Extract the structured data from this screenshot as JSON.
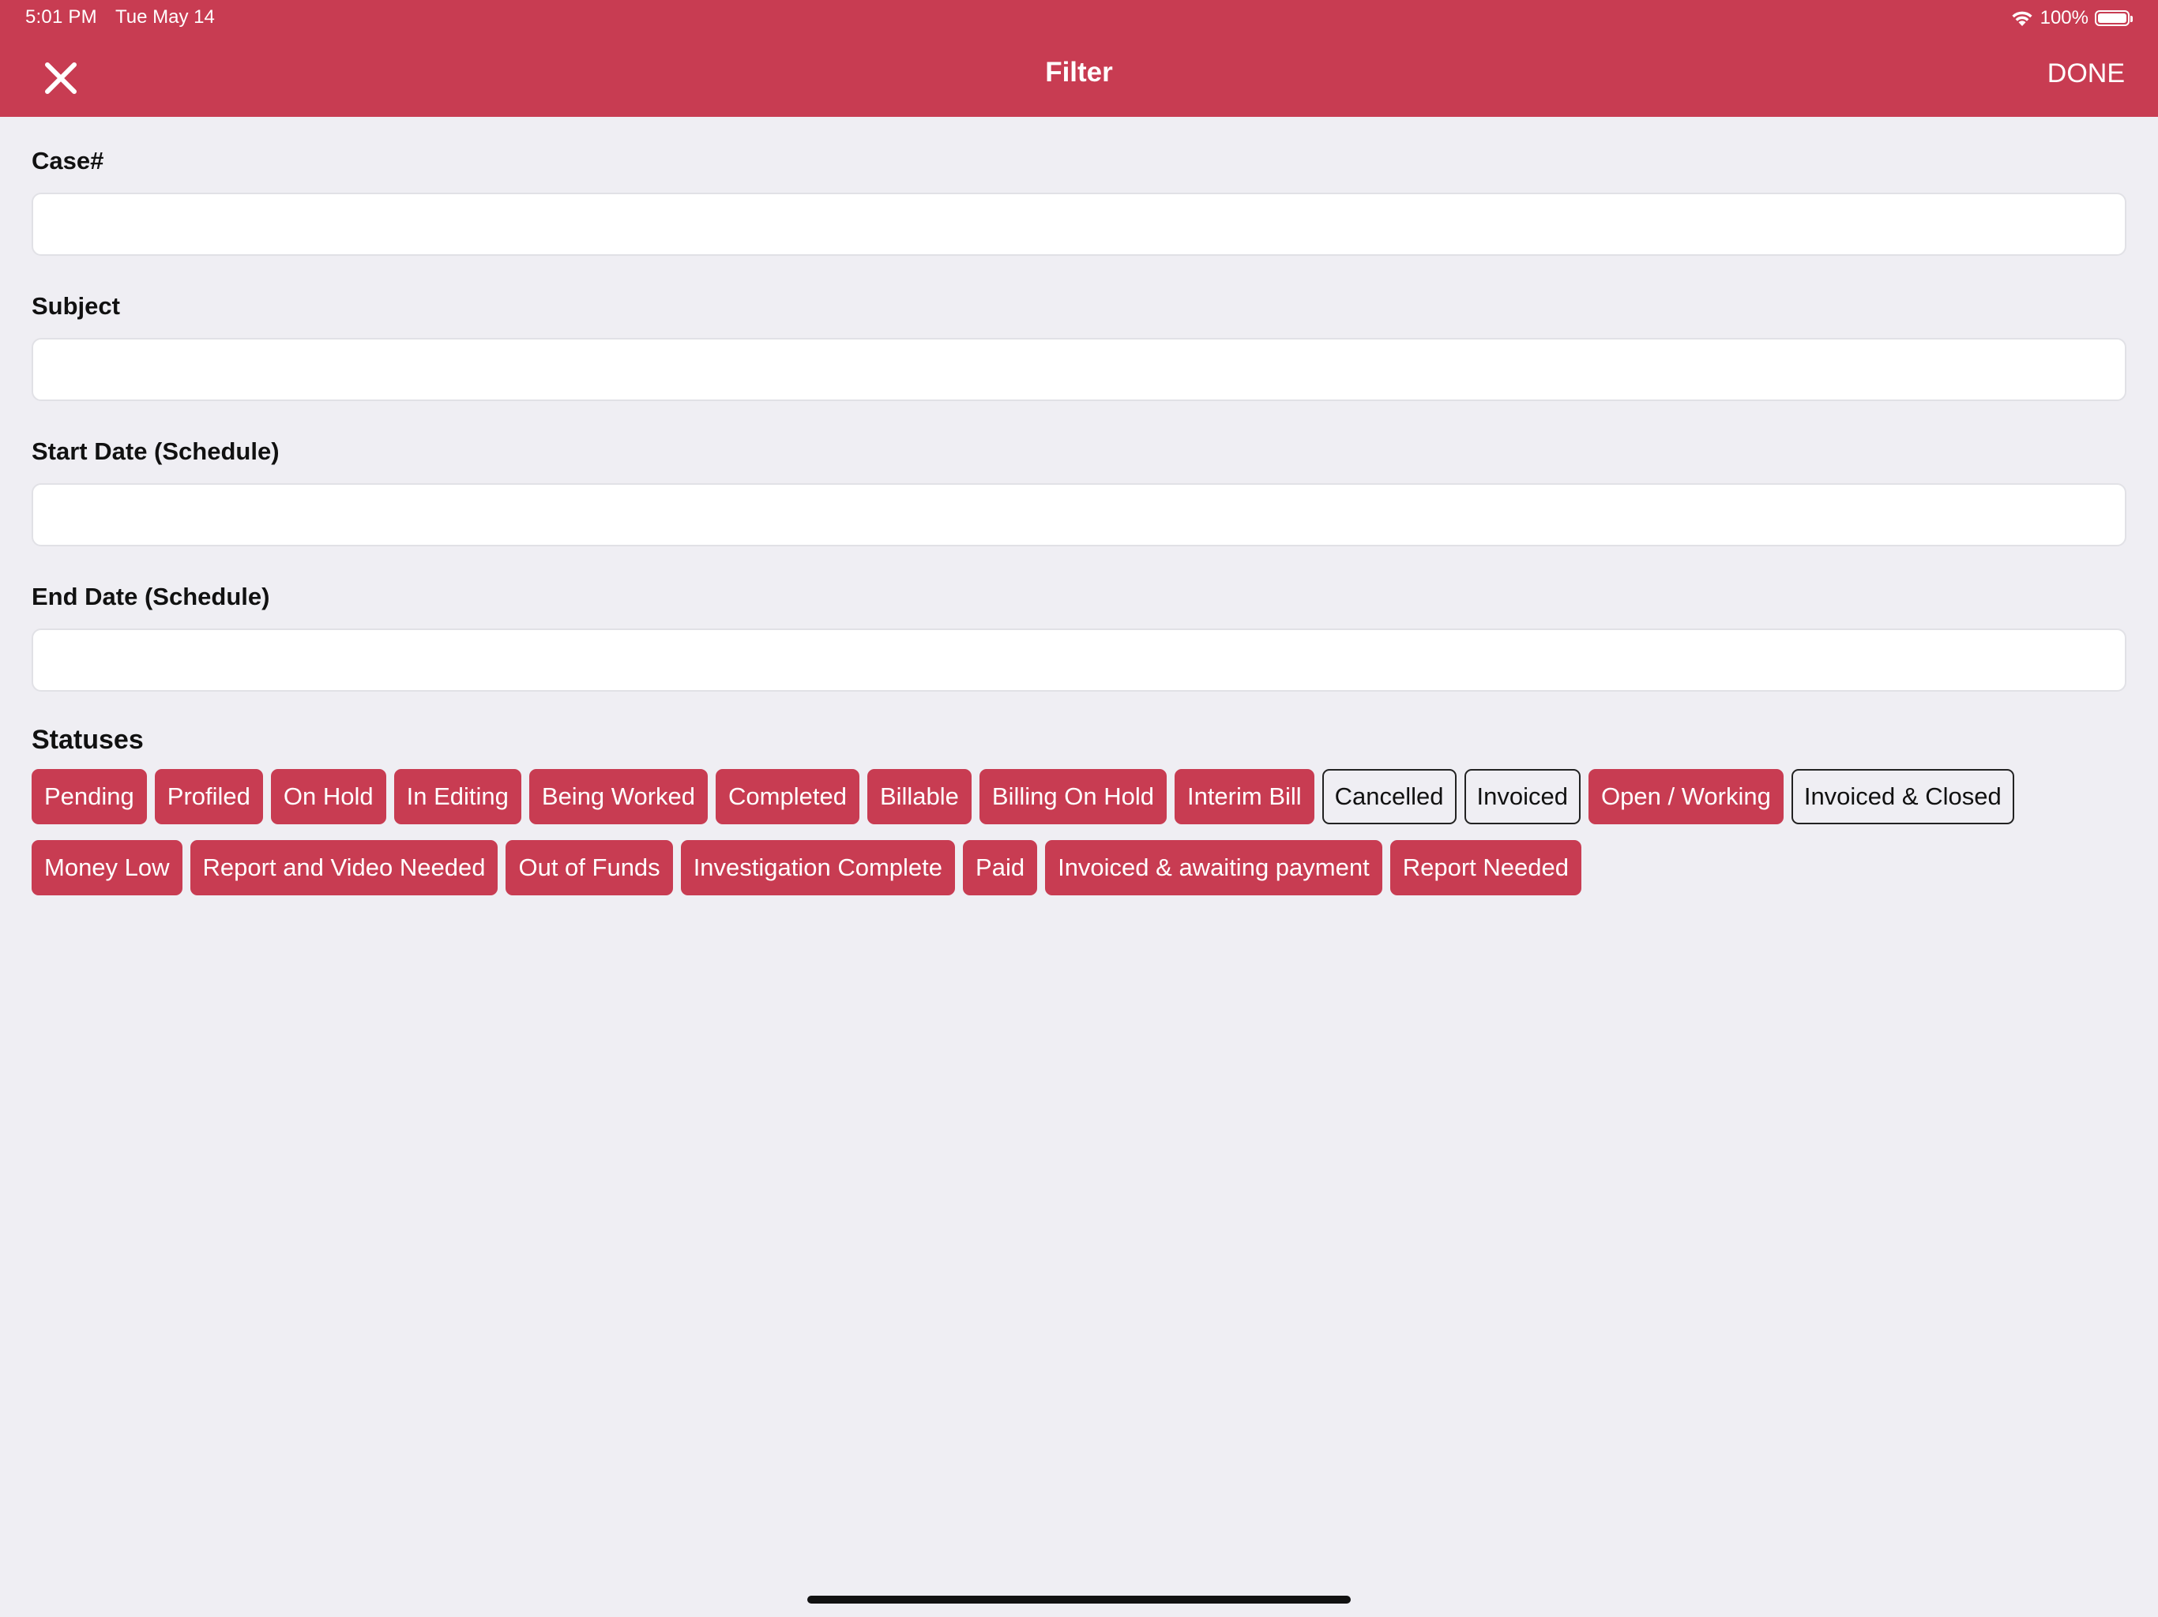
{
  "status_bar": {
    "time": "5:01 PM",
    "date": "Tue May 14",
    "battery": "100%"
  },
  "nav": {
    "title": "Filter",
    "done_label": "DONE",
    "close_icon": "close-icon"
  },
  "fields": {
    "case": {
      "label": "Case#",
      "value": ""
    },
    "subject": {
      "label": "Subject",
      "value": ""
    },
    "start_date": {
      "label": "Start Date (Schedule)",
      "value": ""
    },
    "end_date": {
      "label": "End Date (Schedule)",
      "value": ""
    }
  },
  "statuses": {
    "label": "Statuses",
    "items": [
      {
        "label": "Pending",
        "selected": true
      },
      {
        "label": "Profiled",
        "selected": true
      },
      {
        "label": "On Hold",
        "selected": true
      },
      {
        "label": "In Editing",
        "selected": true
      },
      {
        "label": "Being Worked",
        "selected": true
      },
      {
        "label": "Completed",
        "selected": true
      },
      {
        "label": "Billable",
        "selected": true
      },
      {
        "label": "Billing On Hold",
        "selected": true
      },
      {
        "label": "Interim Bill",
        "selected": true
      },
      {
        "label": "Cancelled",
        "selected": false
      },
      {
        "label": "Invoiced",
        "selected": false
      },
      {
        "label": "Open / Working",
        "selected": true
      },
      {
        "label": "Invoiced & Closed",
        "selected": false
      },
      {
        "label": "Money Low",
        "selected": true
      },
      {
        "label": "Report and Video Needed",
        "selected": true
      },
      {
        "label": "Out of Funds",
        "selected": true
      },
      {
        "label": "Investigation Complete",
        "selected": true
      },
      {
        "label": "Paid",
        "selected": true
      },
      {
        "label": "Invoiced & awaiting payment",
        "selected": true
      },
      {
        "label": "Report Needed",
        "selected": true
      }
    ]
  },
  "colors": {
    "accent": "#c83c52",
    "background": "#efeef3"
  }
}
